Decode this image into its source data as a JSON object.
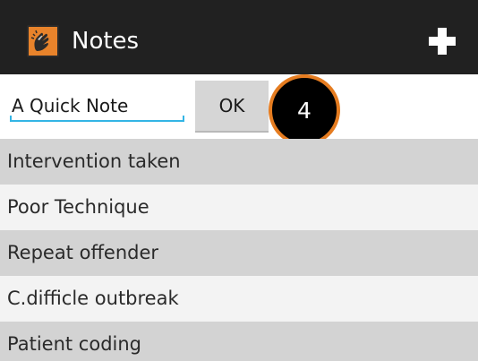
{
  "action_bar": {
    "title": "Notes",
    "app_icon": "clapping-hands-icon",
    "add_icon": "plus-icon",
    "background": "#212121",
    "icon_color": "#e8832b"
  },
  "note_input": {
    "value": "A Quick Note",
    "accent": "#33b5e5"
  },
  "ok_button": {
    "label": "OK"
  },
  "step_badge": {
    "label": "4",
    "ring_color": "#e57c20"
  },
  "notes": [
    {
      "label": "Intervention taken"
    },
    {
      "label": "Poor Technique"
    },
    {
      "label": "Repeat offender"
    },
    {
      "label": "C.difficle outbreak"
    },
    {
      "label": "Patient coding"
    }
  ],
  "list_colors": {
    "odd": "#d3d3d3",
    "even": "#f3f3f3"
  }
}
